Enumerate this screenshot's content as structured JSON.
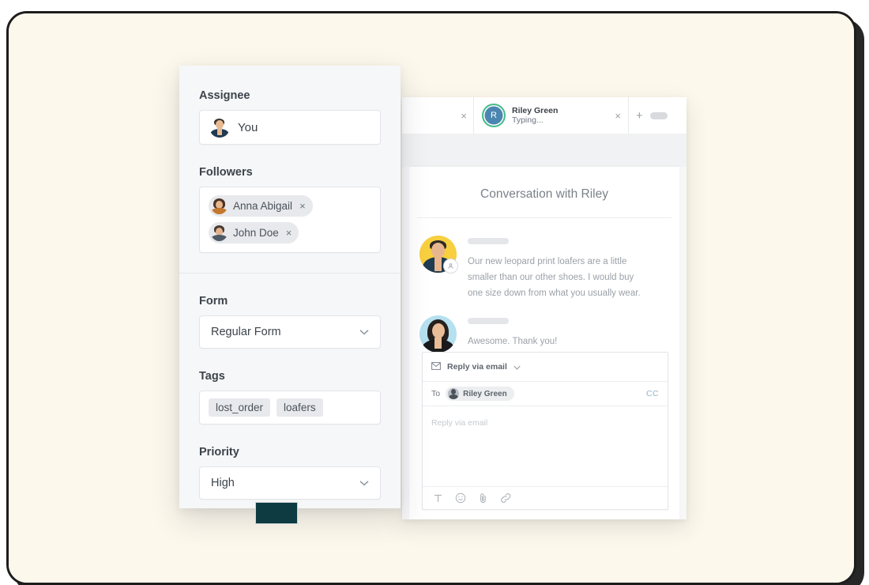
{
  "frame": {
    "background_color": "#fdf8ec",
    "border_color": "#1d1d1d",
    "accent_block_color": "#0e3a42"
  },
  "side_panel": {
    "assignee": {
      "label": "Assignee",
      "value": "You",
      "avatar_name": "assignee-avatar"
    },
    "followers": {
      "label": "Followers",
      "items": [
        {
          "name": "Anna Abigail",
          "remove": "×"
        },
        {
          "name": "John Doe",
          "remove": "×"
        }
      ]
    },
    "form": {
      "label": "Form",
      "value": "Regular Form"
    },
    "tags": {
      "label": "Tags",
      "items": [
        "lost_order",
        "loafers"
      ]
    },
    "priority": {
      "label": "Priority",
      "value": "High"
    }
  },
  "app": {
    "tabs": {
      "partial_tab_close": "×",
      "active": {
        "avatar_initial": "R",
        "name": "Riley Green",
        "status": "Typing...",
        "close": "×",
        "avatar_color": "#4a86b0",
        "ring_color": "#49bd8a"
      },
      "new_tab_plus": "+"
    },
    "conversation": {
      "title": "Conversation with Riley",
      "messages": [
        {
          "author_hidden": true,
          "text": "Our new leopard print loafers are a little smaller than our other shoes. I would buy one size down from what you usually wear.",
          "avatar_bg": "#f7cf3f"
        },
        {
          "author_hidden": true,
          "text": "Awesome. Thank you!",
          "avatar_bg": "#b5e0ef"
        }
      ]
    },
    "composer": {
      "mode_label": "Reply via email",
      "to_label": "To",
      "recipient": "Riley Green",
      "cc_label": "CC",
      "placeholder": "Reply via email",
      "toolbar": [
        {
          "name": "text-format-icon",
          "glyph": "T"
        },
        {
          "name": "emoji-icon",
          "glyph": "☺"
        },
        {
          "name": "attachment-icon",
          "glyph": "📎"
        },
        {
          "name": "link-icon",
          "glyph": "🔗"
        }
      ]
    }
  }
}
